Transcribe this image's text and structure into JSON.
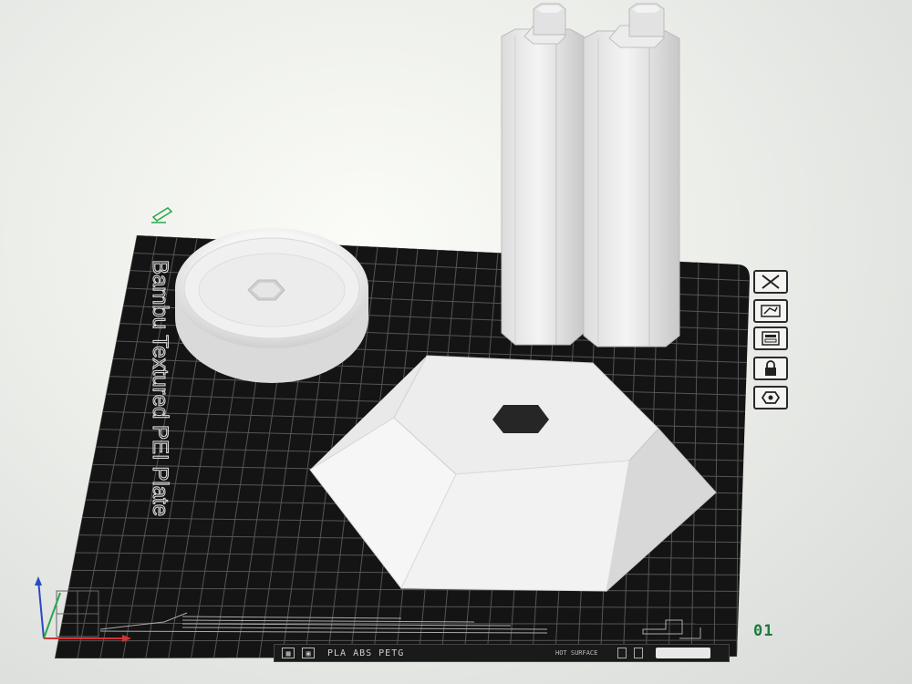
{
  "plate": {
    "name": "Bambu Textured PEI Plate",
    "number": "01",
    "filament": "PLA ABS PETG",
    "surface": "HOT SURFACE"
  },
  "toolbar": {
    "close_icon": "close-icon",
    "arrange_icon": "arrange-icon",
    "layout_icon": "layout-icon",
    "lock_icon": "lock-icon",
    "settings_icon": "plate-settings-icon"
  },
  "colors": {
    "plate": "#141414",
    "grid": "#5a5a5a",
    "model": "#eeeeee",
    "accent_green": "#1d7a3c"
  }
}
